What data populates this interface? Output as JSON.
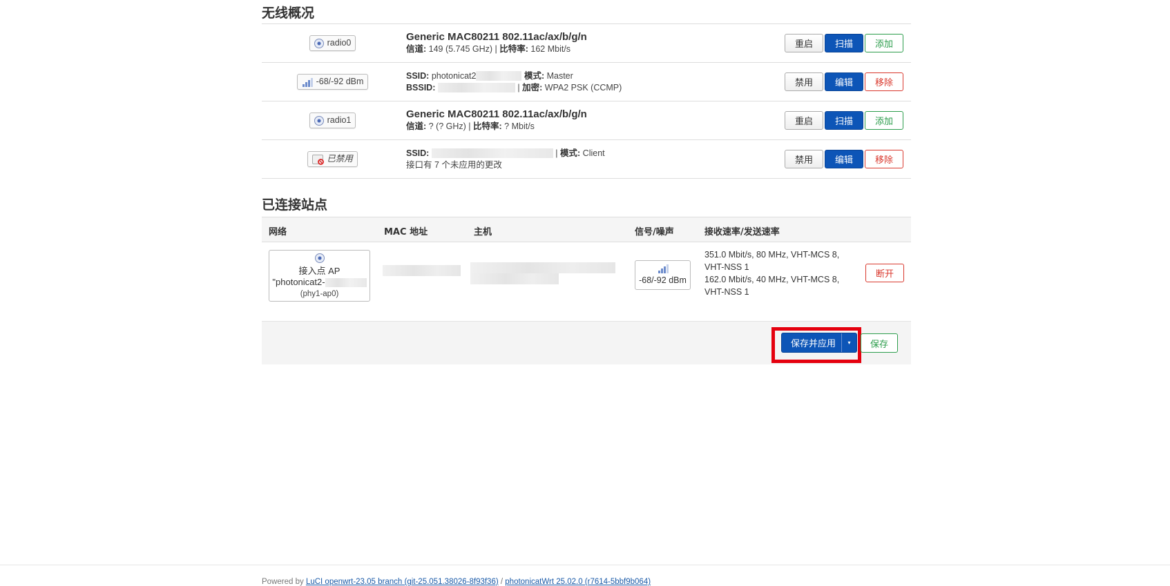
{
  "overview": {
    "title": "无线概况",
    "rows": [
      {
        "badge": "radio0",
        "line1": "Generic MAC80211 802.11ac/ax/b/g/n",
        "label_channel": "信道:",
        "channel": " 149 (5.745 GHz) | ",
        "label_bitrate": "比特率:",
        "bitrate": " 162 Mbit/s",
        "buttons": [
          "重启",
          "扫描",
          "添加"
        ]
      },
      {
        "badge": "-68/-92 dBm",
        "label_ssid": "SSID:",
        "ssid": " photonicat2",
        "label_mode": "模式:",
        "mode": " Master",
        "label_bssid": "BSSID:",
        "sep": " | ",
        "label_enc": "加密:",
        "enc": " WPA2 PSK (CCMP)",
        "buttons": [
          "禁用",
          "编辑",
          "移除"
        ]
      },
      {
        "badge": "radio1",
        "line1": "Generic MAC80211 802.11ac/ax/b/g/n",
        "label_channel": "信道:",
        "channel": " ? (? GHz) | ",
        "label_bitrate": "比特率:",
        "bitrate": " ? Mbit/s",
        "buttons": [
          "重启",
          "扫描",
          "添加"
        ]
      },
      {
        "badge": "已禁用",
        "label_ssid": "SSID:",
        "sep": " | ",
        "label_mode": "模式:",
        "mode": " Client",
        "pending": "接口有 7 个未应用的更改",
        "buttons": [
          "禁用",
          "编辑",
          "移除"
        ]
      }
    ]
  },
  "stations": {
    "title": "已连接站点",
    "headers": [
      "网络",
      "MAC 地址",
      "主机",
      "信号/噪声",
      "接收速率/发送速率"
    ],
    "row": {
      "network_line1": "接入点 AP",
      "network_line2": "\"photonicat2-",
      "network_line3": "(phy1-ap0)",
      "signal": "-68/-92 dBm",
      "rx1": "351.0 Mbit/s, 80 MHz, VHT-MCS 8,",
      "rx2": "VHT-NSS 1",
      "tx1": "162.0 Mbit/s, 40 MHz, VHT-MCS 8,",
      "tx2": "VHT-NSS 1",
      "disconnect": "断开"
    }
  },
  "actions": {
    "save_apply": "保存并应用",
    "save": "保存",
    "caret": "▾"
  },
  "footer": {
    "powered_by": "Powered by ",
    "luci_link": "LuCI openwrt-23.05 branch (git-25.051.38026-8f93f36)",
    "sep": " / ",
    "fw_link": "photonicatWrt 25.02.0 (r7614-5bbf9b064)"
  },
  "colors": {
    "primary": "#0d55b7",
    "positive": "#2b9c4b",
    "negative": "#d9372c",
    "highlight": "#e5000e",
    "link": "#1a73c9"
  }
}
